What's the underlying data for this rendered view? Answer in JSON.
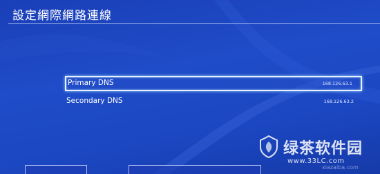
{
  "screen": {
    "title": "設定網際網路連線"
  },
  "dns_list": [
    {
      "label": "Primary DNS",
      "value": "168.126.63.1",
      "selected": true
    },
    {
      "label": "Secondary DNS",
      "value": "168.126.63.2",
      "selected": false
    }
  ],
  "watermark": {
    "text": "绿茶软件园",
    "url": "www.33LC.com",
    "faint": "xiazaiba.com"
  },
  "colors": {
    "background": "#1f4cc8",
    "highlight_border": "#e6f2ff",
    "text": "#ffffff"
  }
}
